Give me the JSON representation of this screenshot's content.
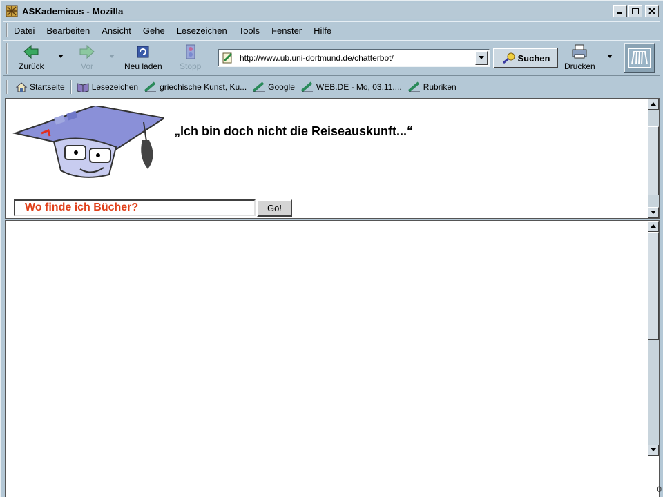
{
  "window": {
    "title": "ASKademicus - Mozilla",
    "controls": [
      "minimize",
      "maximize",
      "close"
    ]
  },
  "menubar": {
    "items": [
      "Datei",
      "Bearbeiten",
      "Ansicht",
      "Gehe",
      "Lesezeichen",
      "Tools",
      "Fenster",
      "Hilfe"
    ]
  },
  "navbar": {
    "back_label": "Zurück",
    "forward_label": "Vor",
    "reload_label": "Neu laden",
    "stop_label": "Stopp",
    "url": "http://www.ub.uni-dortmund.de/chatterbot/",
    "search_label": "Suchen",
    "print_label": "Drucken"
  },
  "personal_toolbar": {
    "items": [
      "Startseite",
      "Lesezeichen",
      "griechische Kunst, Ku...",
      "Google",
      "WEB.DE - Mo, 03.11....",
      "Rubriken"
    ]
  },
  "content": {
    "quote": "„Ich bin doch nicht die Reiseauskunft...“",
    "query_value": "Wo finde ich Bücher?",
    "go_label": "Go!"
  },
  "status": {
    "corner_text": "0"
  },
  "colors": {
    "chrome": "#b4c8d6",
    "query_text": "#e0401a",
    "page_bg": "#ffffff"
  }
}
